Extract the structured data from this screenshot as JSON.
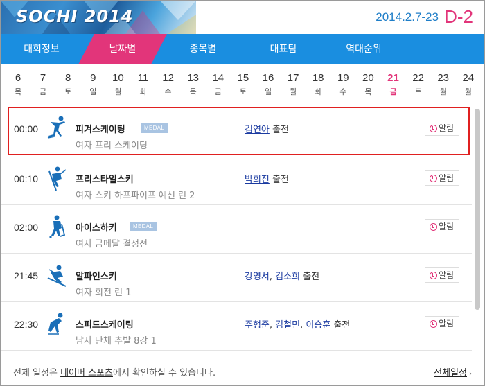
{
  "header": {
    "logo": "SOCHI 2014",
    "dates": "2014.2.7-23",
    "dday": "D-2"
  },
  "nav": {
    "items": [
      {
        "label": "대회정보"
      },
      {
        "label": "날짜별"
      },
      {
        "label": "종목별"
      },
      {
        "label": "대표팀"
      },
      {
        "label": "역대순위"
      }
    ],
    "active_index": 1
  },
  "days": [
    {
      "num": "6",
      "wd": "목"
    },
    {
      "num": "7",
      "wd": "금"
    },
    {
      "num": "8",
      "wd": "토"
    },
    {
      "num": "9",
      "wd": "일"
    },
    {
      "num": "10",
      "wd": "월"
    },
    {
      "num": "11",
      "wd": "화"
    },
    {
      "num": "12",
      "wd": "수"
    },
    {
      "num": "13",
      "wd": "목"
    },
    {
      "num": "14",
      "wd": "금"
    },
    {
      "num": "15",
      "wd": "토"
    },
    {
      "num": "16",
      "wd": "일"
    },
    {
      "num": "17",
      "wd": "월"
    },
    {
      "num": "18",
      "wd": "화"
    },
    {
      "num": "19",
      "wd": "수"
    },
    {
      "num": "20",
      "wd": "목"
    },
    {
      "num": "21",
      "wd": "금"
    },
    {
      "num": "22",
      "wd": "토"
    },
    {
      "num": "23",
      "wd": "월"
    },
    {
      "num": "24",
      "wd": "월"
    }
  ],
  "active_day": "21",
  "schedule": [
    {
      "time": "00:00",
      "sport": "피겨스케이팅",
      "medal": "MEDAL",
      "event": "여자 프리 스케이팅",
      "athletes": [
        "김연아"
      ],
      "suffix": "출전",
      "alarm": "알림",
      "icon": "figure-skating-icon"
    },
    {
      "time": "00:10",
      "sport": "프리스타일스키",
      "medal": "",
      "event": "여자 스키 하프파이프 예선 런 2",
      "athletes": [
        "박희진"
      ],
      "suffix": "출전",
      "alarm": "알림",
      "icon": "freestyle-ski-icon"
    },
    {
      "time": "02:00",
      "sport": "아이스하키",
      "medal": "MEDAL",
      "event": "여자 금메달 결정전",
      "athletes": [],
      "suffix": "",
      "alarm": "알림",
      "icon": "ice-hockey-icon"
    },
    {
      "time": "21:45",
      "sport": "알파인스키",
      "medal": "",
      "event": "여자 회전 런 1",
      "athletes": [
        "강영서",
        "김소희"
      ],
      "suffix": "출전",
      "alarm": "알림",
      "icon": "alpine-ski-icon"
    },
    {
      "time": "22:30",
      "sport": "스피드스케이팅",
      "medal": "",
      "event": "남자 단체 추발 8강 1",
      "athletes": [
        "주형준",
        "김철민",
        "이승훈"
      ],
      "suffix": "출전",
      "alarm": "알림",
      "icon": "speed-skating-icon"
    }
  ],
  "footer": {
    "text_before": "전체 일정은 ",
    "link_inline": "네이버 스포츠",
    "text_after": "에서 확인하실 수 있습니다.",
    "full_link": "전체일정"
  },
  "colors": {
    "nav_bg": "#1a8ee0",
    "accent_pink": "#e2357a",
    "date_blue": "#1f7ec8",
    "athlete_blue": "#1a3aa0",
    "selected_border": "#e02020"
  }
}
